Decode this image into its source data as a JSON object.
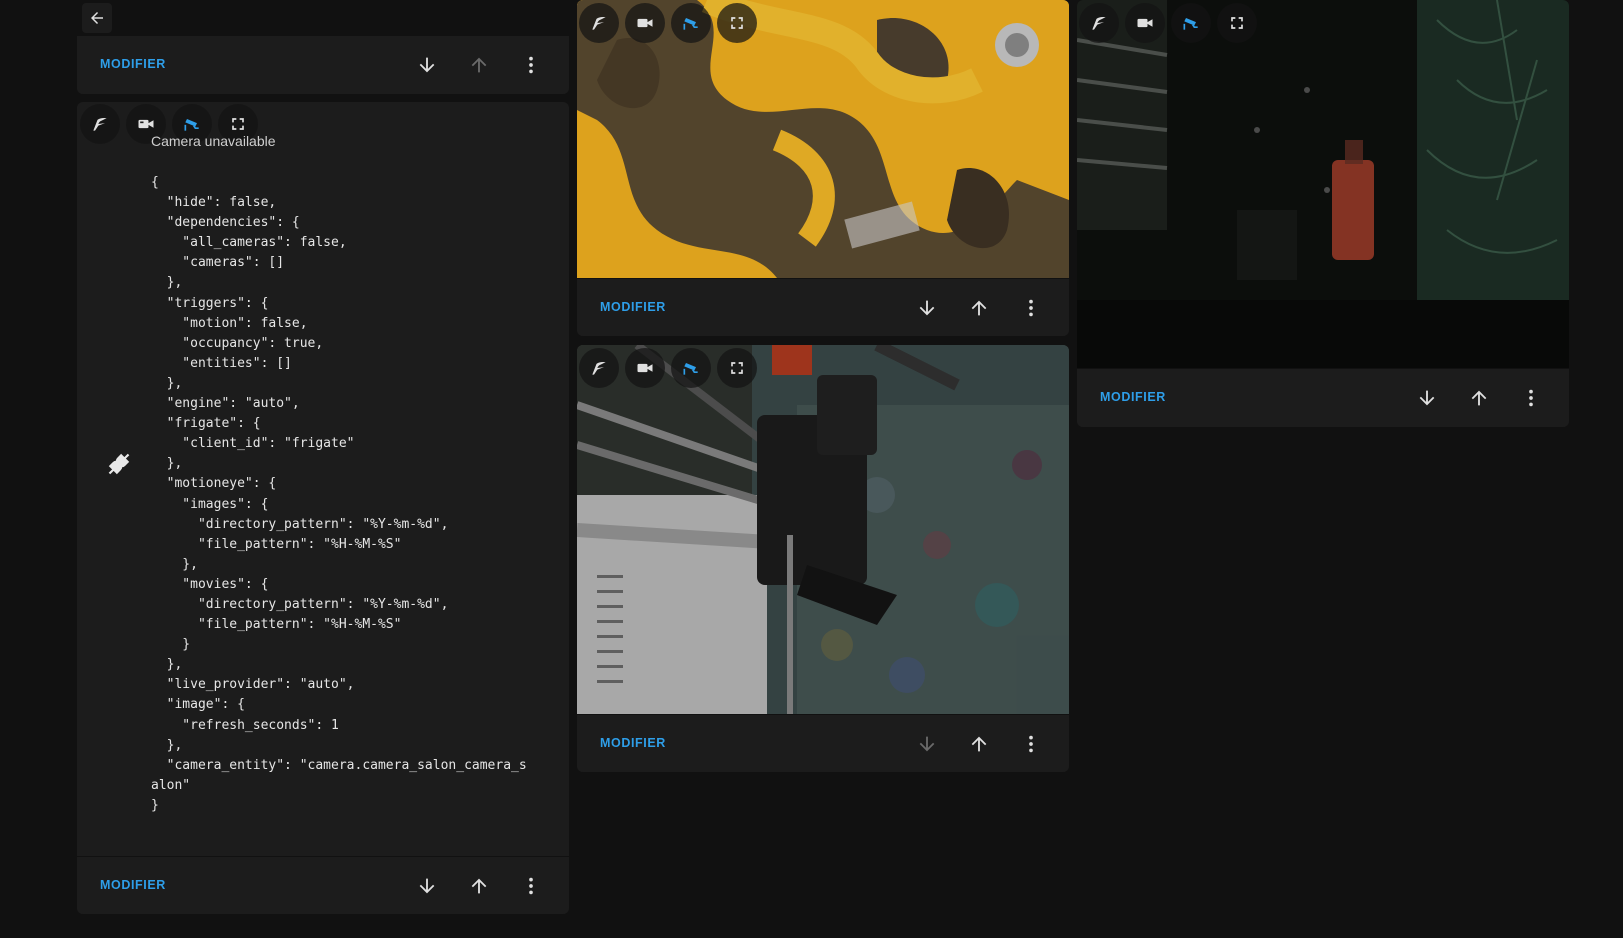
{
  "header": {
    "back_icon": "arrow-left-icon"
  },
  "modifier_label": "MODIFIER",
  "icons": {
    "move_down": "arrow-down-icon",
    "move_up": "arrow-up-icon",
    "more": "dots-vertical-icon",
    "frigate": "frigate-icon",
    "camera": "video-camera-icon",
    "cctv": "cctv-icon",
    "fullscreen": "fullscreen-icon",
    "disconnected": "plug-disconnected-icon"
  },
  "colors": {
    "accent": "#2e9ee8",
    "background": "#111111",
    "card": "#1c1c1c"
  },
  "config_card": {
    "camera_status": "Camera unavailable",
    "config_lines": [
      "{",
      "  \"hide\": false,",
      "  \"dependencies\": {",
      "    \"all_cameras\": false,",
      "    \"cameras\": []",
      "  },",
      "  \"triggers\": {",
      "    \"motion\": false,",
      "    \"occupancy\": true,",
      "    \"entities\": []",
      "  },",
      "  \"engine\": \"auto\",",
      "  \"frigate\": {",
      "    \"client_id\": \"frigate\"",
      "  },",
      "  \"motioneye\": {",
      "    \"images\": {",
      "      \"directory_pattern\": \"%Y-%m-%d\",",
      "      \"file_pattern\": \"%H-%M-%S\"",
      "    },",
      "    \"movies\": {",
      "      \"directory_pattern\": \"%Y-%m-%d\",",
      "      \"file_pattern\": \"%H-%M-%S\"",
      "    }",
      "  },",
      "  \"live_provider\": \"auto\",",
      "  \"image\": {",
      "    \"refresh_seconds\": 1",
      "  },",
      "  \"camera_entity\": \"camera.camera_salon_camera_s",
      "alon\"",
      "}"
    ]
  }
}
